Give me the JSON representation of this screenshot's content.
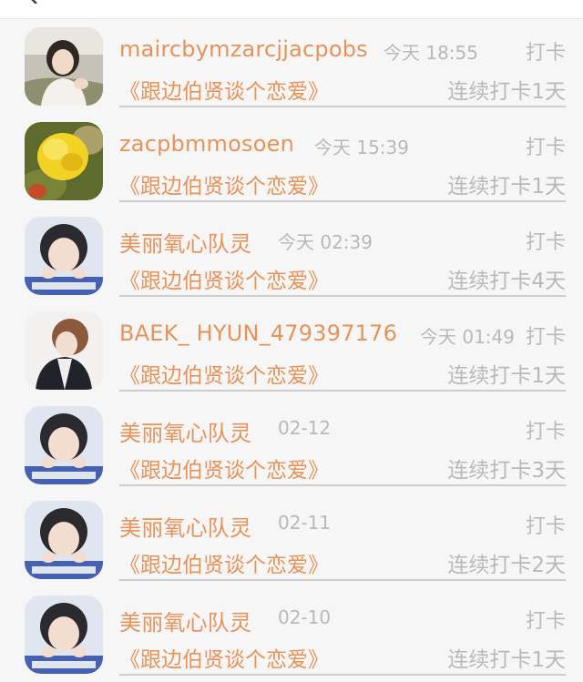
{
  "records": [
    {
      "name": "maircbymzarcjjacpobs",
      "time": "今天 18:55",
      "action": "打卡",
      "title": "《跟边伯贤谈个恋爱》",
      "streak": "连续打卡1天",
      "avatar": "girl-photo"
    },
    {
      "name": "zacpbmmosoen",
      "time": "今天 15:39",
      "action": "打卡",
      "title": "《跟边伯贤谈个恋爱》",
      "streak": "连续打卡1天",
      "avatar": "yellow-flower"
    },
    {
      "name": "美丽氧心队灵",
      "time": "今天 02:39",
      "action": "打卡",
      "title": "《跟边伯贤谈个恋爱》",
      "streak": "连续打卡4天",
      "avatar": "boy-portrait"
    },
    {
      "name": "BAEK_ HYUN_479397176",
      "time": "今天 01:49",
      "action": "打卡",
      "title": "《跟边伯贤谈个恋爱》",
      "streak": "连续打卡1天",
      "avatar": "boy-side"
    },
    {
      "name": "美丽氧心队灵",
      "time": "02-12",
      "action": "打卡",
      "title": "《跟边伯贤谈个恋爱》",
      "streak": "连续打卡3天",
      "avatar": "boy-portrait"
    },
    {
      "name": "美丽氧心队灵",
      "time": "02-11",
      "action": "打卡",
      "title": "《跟边伯贤谈个恋爱》",
      "streak": "连续打卡2天",
      "avatar": "boy-portrait"
    },
    {
      "name": "美丽氧心队灵",
      "time": "02-10",
      "action": "打卡",
      "title": "《跟边伯贤谈个恋爱》",
      "streak": "连续打卡1天",
      "avatar": "boy-portrait"
    }
  ],
  "colors": {
    "accent": "#e6935a",
    "muted": "#b9b9b9",
    "divider": "#cfcfcf",
    "background": "#f7f6f6"
  }
}
